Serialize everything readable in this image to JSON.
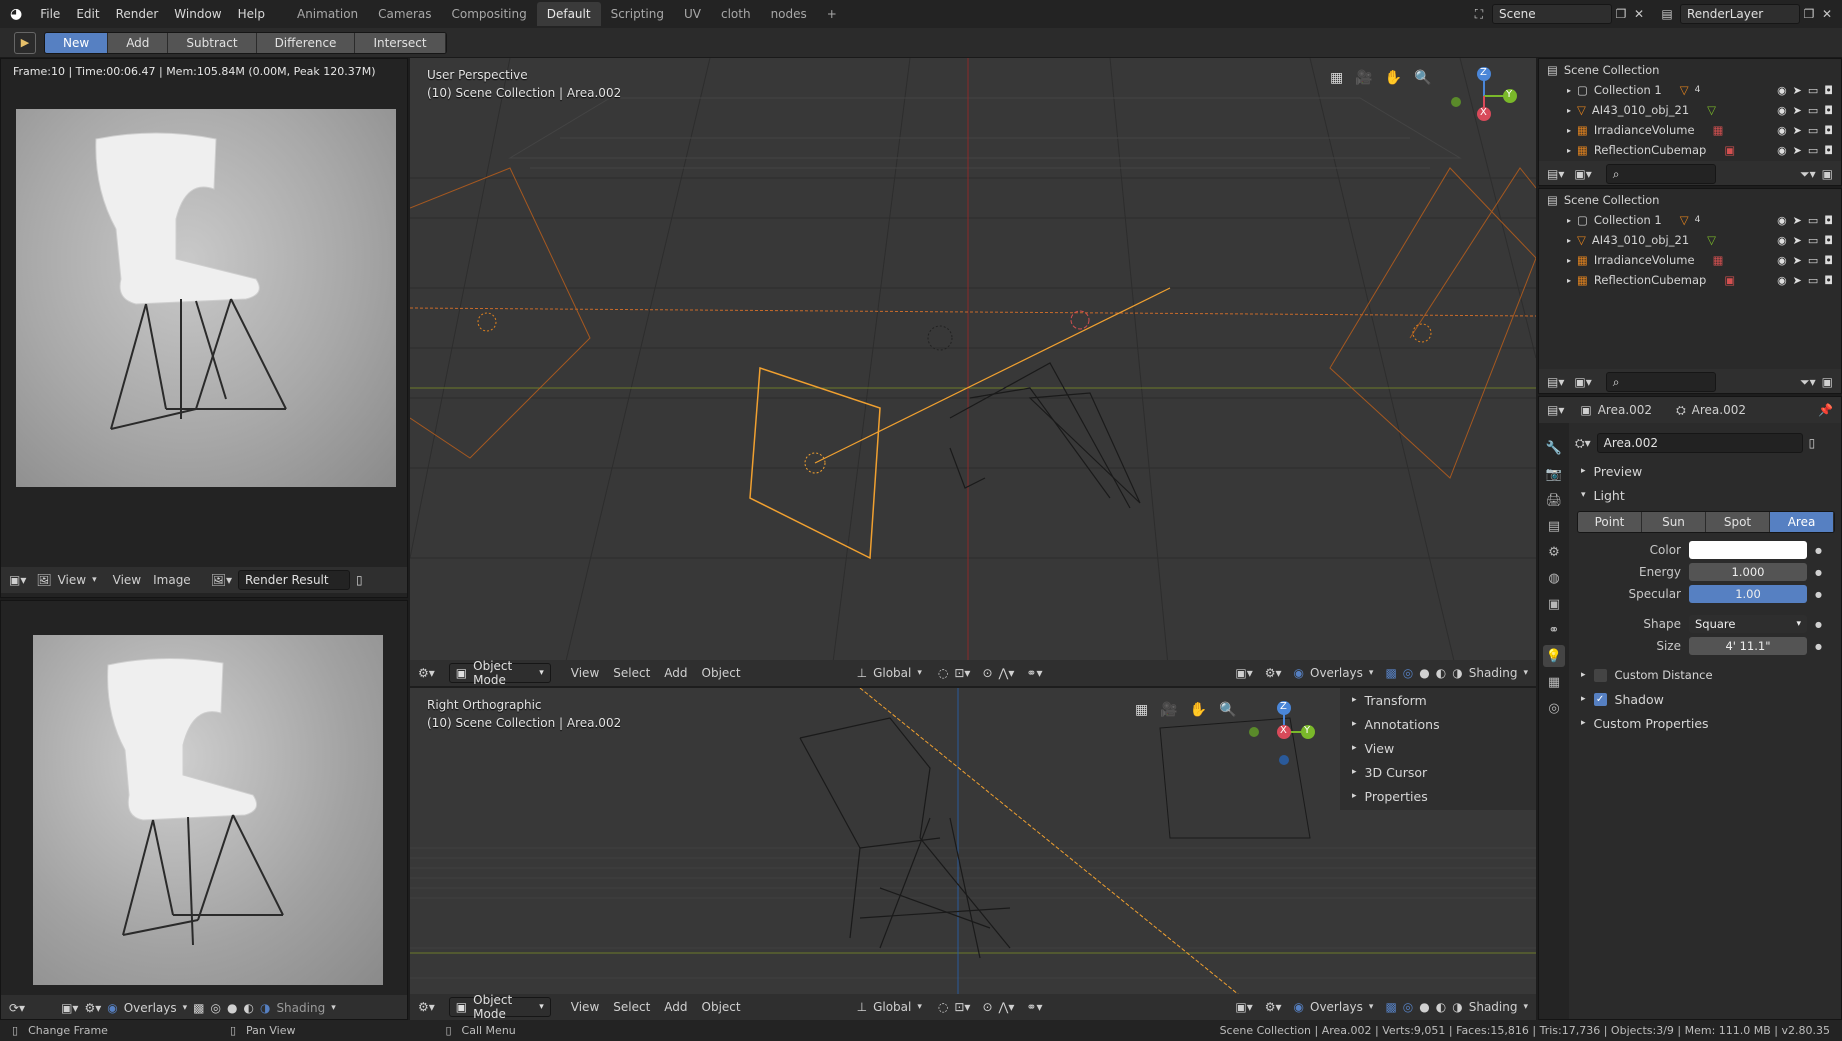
{
  "topbar": {
    "menus": [
      "File",
      "Edit",
      "Render",
      "Window",
      "Help"
    ],
    "workspaces": [
      "Animation",
      "Cameras",
      "Compositing",
      "Default",
      "Scripting",
      "UV",
      "cloth",
      "nodes"
    ],
    "active_workspace": "Default",
    "add_tab": "+",
    "scene": "Scene",
    "view_layer": "RenderLayer"
  },
  "toolbar": {
    "modes": [
      "New",
      "Add",
      "Subtract",
      "Difference",
      "Intersect"
    ],
    "active_mode": "New"
  },
  "render_panel": {
    "stats": "Frame:10 | Time:00:06.47 | Mem:105.84M (0.00M, Peak 120.37M)",
    "header": {
      "view": "View",
      "view2": "View",
      "image": "Image",
      "result": "Render Result"
    }
  },
  "viewport_top": {
    "title": "User Perspective",
    "subtitle": "(10) Scene Collection | Area.002",
    "header": {
      "mode": "Object Mode",
      "view": "View",
      "select": "Select",
      "add": "Add",
      "object": "Object",
      "orientation": "Global",
      "overlays": "Overlays",
      "shading": "Shading"
    },
    "gizmo": {
      "z": "Z",
      "y": "Y",
      "x": "X"
    }
  },
  "viewport_bottom": {
    "title": "Right Orthographic",
    "subtitle": "(10) Scene Collection | Area.002",
    "header": {
      "mode": "Object Mode",
      "view": "View",
      "select": "Select",
      "add": "Add",
      "object": "Object",
      "orientation": "Global",
      "overlays": "Overlays",
      "shading": "Shading"
    },
    "sidebar": [
      "Transform",
      "Annotations",
      "View",
      "3D Cursor",
      "Properties"
    ],
    "gizmo": {
      "z": "Z",
      "y": "Y",
      "x": "X"
    }
  },
  "bottom_left_header": {
    "overlays": "Overlays",
    "shading": "Shading"
  },
  "outliner_top": {
    "root": "Scene Collection",
    "items": [
      {
        "name": "Collection 1",
        "badge": "4"
      },
      {
        "name": "AI43_010_obj_21",
        "badge": ""
      },
      {
        "name": "IrradianceVolume",
        "badge": ""
      },
      {
        "name": "ReflectionCubemap",
        "badge": ""
      }
    ]
  },
  "outliner_bottom": {
    "root": "Scene Collection",
    "items": [
      {
        "name": "Collection 1",
        "badge": "4"
      },
      {
        "name": "AI43_010_obj_21",
        "badge": ""
      },
      {
        "name": "IrradianceVolume",
        "badge": ""
      },
      {
        "name": "ReflectionCubemap",
        "badge": ""
      }
    ]
  },
  "properties": {
    "object_name": "Area.002",
    "data_name": "Area.002",
    "datablock": "Area.002",
    "sections": {
      "preview": "Preview",
      "light": "Light",
      "custom_distance": "Custom Distance",
      "shadow": "Shadow",
      "custom_properties": "Custom Properties"
    },
    "light_types": [
      "Point",
      "Sun",
      "Spot",
      "Area"
    ],
    "active_light_type": "Area",
    "fields": {
      "color_label": "Color",
      "energy_label": "Energy",
      "energy": "1.000",
      "specular_label": "Specular",
      "specular": "1.00",
      "shape_label": "Shape",
      "shape": "Square",
      "size_label": "Size",
      "size": "4' 11.1\""
    },
    "custom_distance_checked": false,
    "shadow_checked": true
  },
  "statusbar": {
    "left1": "Change Frame",
    "left2": "Pan View",
    "left3": "Call Menu",
    "right": "Scene Collection | Area.002 | Verts:9,051 | Faces:15,816 | Tris:17,736 | Objects:3/9 | Mem: 111.0 MB | v2.80.35"
  },
  "colors": {
    "accent": "#5680c2",
    "orange": "#e0821e",
    "light_orange": "#f0a030",
    "grid": "#4a4a4a"
  }
}
